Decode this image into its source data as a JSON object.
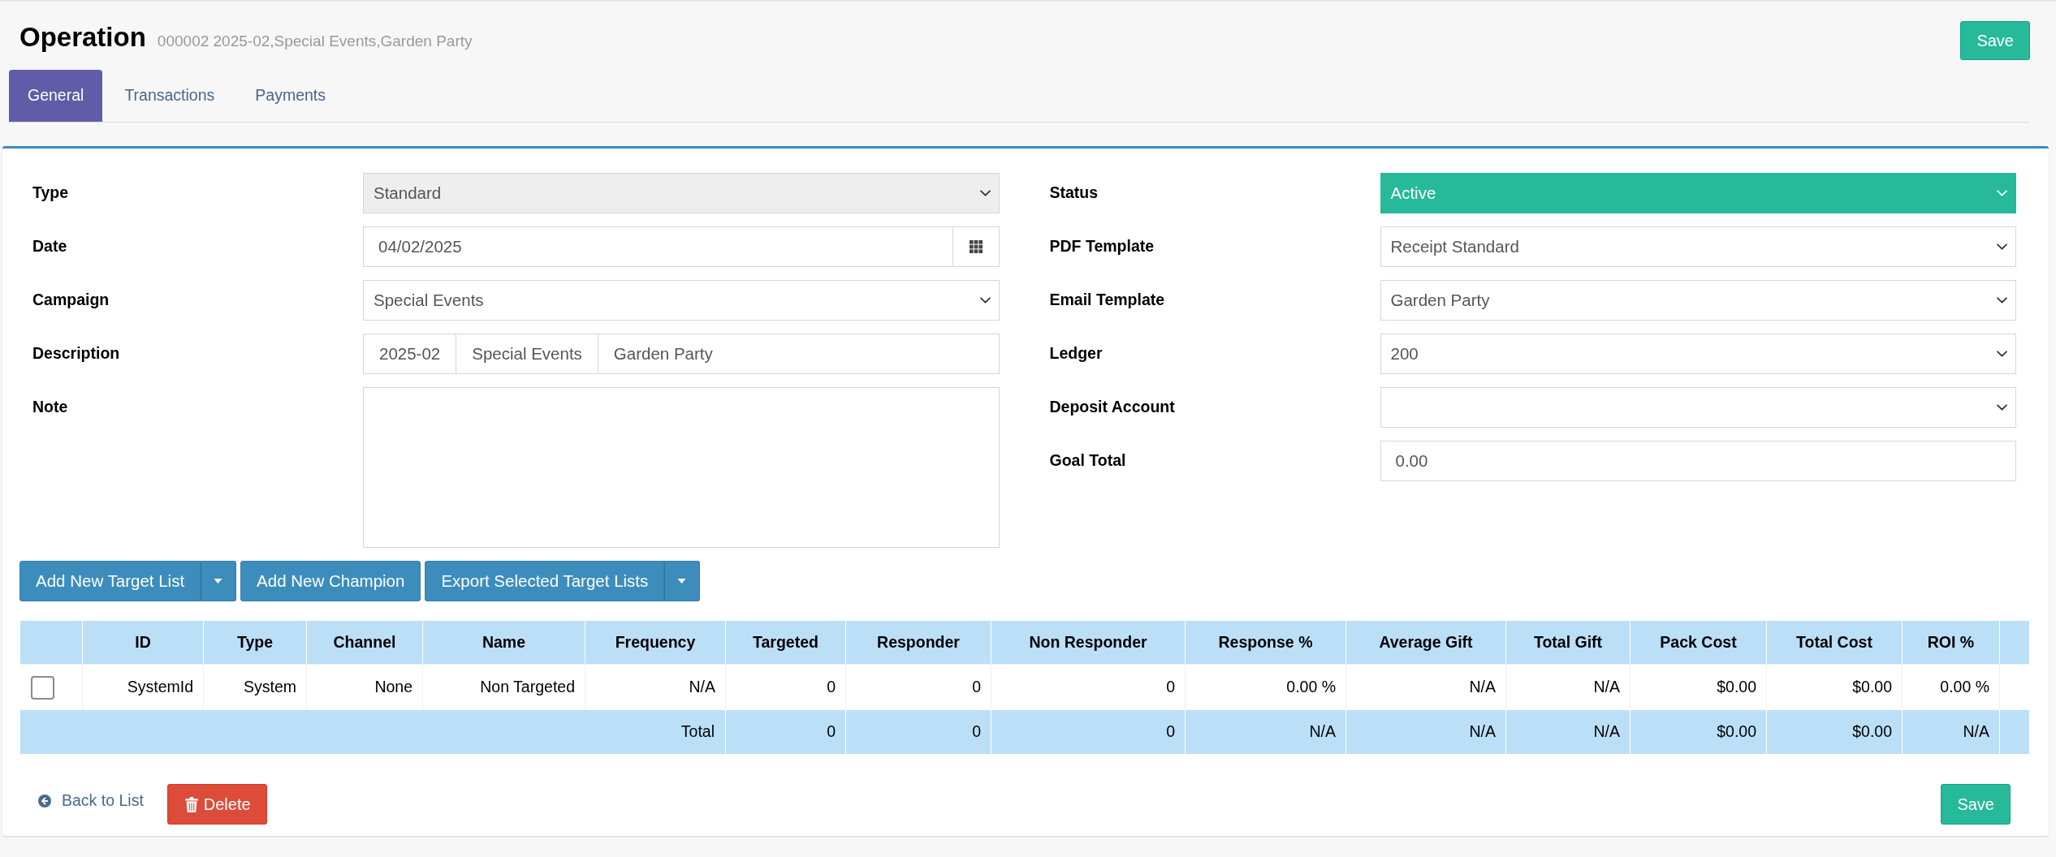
{
  "header": {
    "title": "Operation",
    "subtitle": "000002 2025-02,Special Events,Garden Party",
    "save_button": "Save"
  },
  "tabs": [
    {
      "label": "General",
      "selected": true
    },
    {
      "label": "Transactions",
      "selected": false
    },
    {
      "label": "Payments",
      "selected": false
    }
  ],
  "form_left": [
    {
      "kind": "select",
      "label": "Type",
      "value": "Standard",
      "disabled": true
    },
    {
      "kind": "date",
      "label": "Date",
      "value": "04/02/2025",
      "disabled": false
    },
    {
      "kind": "select",
      "label": "Campaign",
      "value": "Special Events",
      "disabled": false
    },
    {
      "kind": "segments",
      "label": "Description",
      "segments": [
        "2025-02",
        "Special Events"
      ],
      "value": "Garden Party",
      "disabled": false
    },
    {
      "kind": "textarea",
      "label": "Note",
      "disabled": false
    }
  ],
  "form_right": [
    {
      "kind": "select",
      "label": "Status",
      "value": "Active",
      "color": "#26b99a",
      "disabled": false
    },
    {
      "kind": "select",
      "label": "PDF Template",
      "value": "Receipt Standard",
      "disabled": false
    },
    {
      "kind": "select",
      "label": "Email Template",
      "value": "Garden Party",
      "disabled": false
    },
    {
      "kind": "select",
      "label": "Ledger",
      "value": "200",
      "disabled": false
    },
    {
      "kind": "select",
      "label": "Deposit Account",
      "disabled": false
    },
    {
      "kind": "text",
      "label": "Goal Total",
      "value": "0.00",
      "disabled": false
    }
  ],
  "action_buttons": [
    {
      "label": "Add New Target List",
      "has_dropdown": true
    },
    {
      "label": "Add New Champion",
      "has_dropdown": false
    },
    {
      "label": "Export Selected Target Lists",
      "has_dropdown": true
    }
  ],
  "table": {
    "columns": [
      "ID",
      "Type",
      "Channel",
      "Name",
      "Frequency",
      "Targeted",
      "Responder",
      "Non Responder",
      "Response %",
      "Average Gift",
      "Total Gift",
      "Pack Cost",
      "Total Cost",
      "ROI %"
    ],
    "rows": [
      {
        "checked": false,
        "cells": [
          "SystemId",
          "System",
          "None",
          "Non Targeted",
          "N/A",
          "0",
          "0",
          "0",
          "0.00 %",
          "N/A",
          "N/A",
          "$0.00",
          "$0.00",
          "0.00 %"
        ]
      }
    ],
    "total_row": {
      "label": "Total",
      "cells": [
        "0",
        "0",
        "0",
        "N/A",
        "N/A",
        "N/A",
        "$0.00",
        "$0.00",
        "N/A"
      ]
    }
  },
  "footer": {
    "back_link": "Back to List",
    "delete_button": "Delete",
    "save_button": "Save"
  }
}
